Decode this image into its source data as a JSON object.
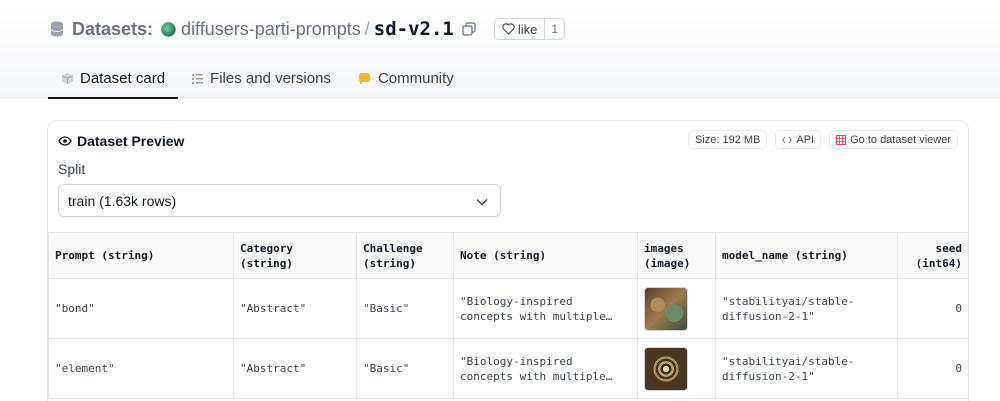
{
  "header": {
    "section_label": "Datasets:",
    "org": "diffusers-parti-prompts",
    "separator": "/",
    "dataset": "sd-v2.1",
    "like_label": "like",
    "like_count": "1"
  },
  "tabs": [
    {
      "label": "Dataset card",
      "active": true,
      "icon": "cube-icon"
    },
    {
      "label": "Files and versions",
      "active": false,
      "icon": "files-icon"
    },
    {
      "label": "Community",
      "active": false,
      "icon": "community-icon"
    }
  ],
  "preview": {
    "title": "Dataset Preview",
    "size_chip": "Size: 192 MB",
    "api_chip": "API",
    "viewer_chip": "Go to dataset viewer",
    "split_label": "Split",
    "split_value": "train (1.63k rows)"
  },
  "table": {
    "columns": [
      {
        "line1": "Prompt (string)",
        "line2": ""
      },
      {
        "line1": "Category",
        "line2": "(string)"
      },
      {
        "line1": "Challenge",
        "line2": "(string)"
      },
      {
        "line1": "Note (string)",
        "line2": ""
      },
      {
        "line1": "images",
        "line2": "(image)"
      },
      {
        "line1": "model_name (string)",
        "line2": ""
      },
      {
        "line1": "seed",
        "line2": "(int64)"
      }
    ],
    "rows": [
      {
        "prompt": "\"bond\"",
        "category": "\"Abstract\"",
        "challenge": "\"Basic\"",
        "note_l1": "\"Biology-inspired",
        "note_l2": "concepts with multiple…",
        "model_l1": "\"stabilityai/stable-",
        "model_l2": "diffusion-2-1\"",
        "seed": "0"
      },
      {
        "prompt": "\"element\"",
        "category": "\"Abstract\"",
        "challenge": "\"Basic\"",
        "note_l1": "\"Biology-inspired",
        "note_l2": "concepts with multiple…",
        "model_l1": "\"stabilityai/stable-",
        "model_l2": "diffusion-2-1\"",
        "seed": "0"
      }
    ]
  },
  "colors": {
    "accent": "#111827",
    "muted": "#6b7280",
    "border": "#e5e7eb",
    "community_icon": "#f5b642",
    "viewer_icon": "#ef4444"
  }
}
